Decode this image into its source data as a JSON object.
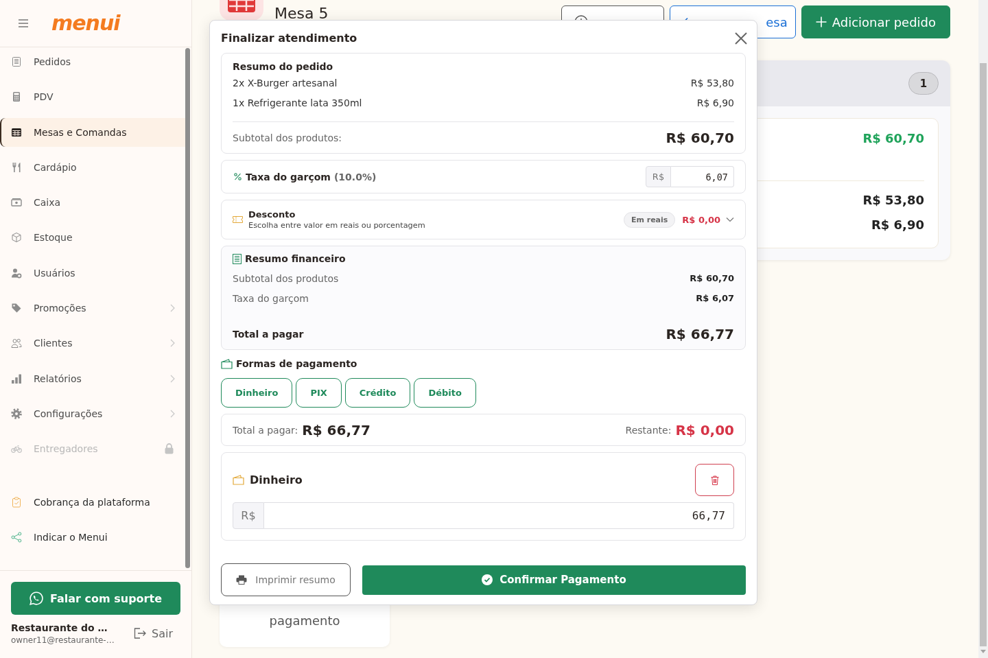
{
  "sidebar": {
    "logo": "menui",
    "items": [
      {
        "label": "Pedidos",
        "kind": "link",
        "selected": false,
        "disabled": false
      },
      {
        "label": "PDV",
        "kind": "link",
        "selected": false,
        "disabled": false
      },
      {
        "label": "Mesas e Comandas",
        "kind": "link",
        "selected": true,
        "disabled": false
      },
      {
        "label": "Cardápio",
        "kind": "link",
        "selected": false,
        "disabled": false
      },
      {
        "label": "Caixa",
        "kind": "link",
        "selected": false,
        "disabled": false
      },
      {
        "label": "Estoque",
        "kind": "link",
        "selected": false,
        "disabled": false
      },
      {
        "label": "Usuários",
        "kind": "link",
        "selected": false,
        "disabled": false
      },
      {
        "label": "Promoções",
        "kind": "group",
        "selected": false,
        "disabled": false
      },
      {
        "label": "Clientes",
        "kind": "group",
        "selected": false,
        "disabled": false
      },
      {
        "label": "Relatórios",
        "kind": "group",
        "selected": false,
        "disabled": false
      },
      {
        "label": "Configurações",
        "kind": "group",
        "selected": false,
        "disabled": false
      },
      {
        "label": "Entregadores",
        "kind": "link",
        "selected": false,
        "disabled": true
      }
    ],
    "extra_links": [
      {
        "label": "Cobrança da plataforma"
      },
      {
        "label": "Indicar o Menui"
      }
    ],
    "support_button": "Falar com suporte",
    "account": {
      "name": "Restaurante do …",
      "email": "owner11@restaurante-…",
      "logout": "Sair"
    }
  },
  "header": {
    "title": "Mesa 5",
    "buttons": [
      {
        "kind": "outline"
      },
      {
        "label": "esa",
        "kind": "secondary"
      },
      {
        "label": "Adicionar pedido",
        "kind": "primary"
      }
    ]
  },
  "hint_card": {
    "text": "pagamento"
  },
  "table_panel": {
    "count": "1",
    "total": "R$ 60,70",
    "prices": [
      "R$ 53,80",
      "R$ 6,90"
    ]
  },
  "modal": {
    "title": "Finalizar atendimento",
    "order_summary": {
      "title": "Resumo do pedido",
      "items": [
        {
          "name": "2x X-Burger artesanal",
          "price": "R$ 53,80"
        },
        {
          "name": "1x Refrigerante lata 350ml",
          "price": "R$ 6,90"
        }
      ],
      "subtotal_label": "Subtotal dos produtos:",
      "subtotal": "R$ 60,70"
    },
    "service_fee": {
      "label": "Taxa do garçom",
      "rate": "(10.0%)",
      "currency": "R$",
      "value": "6,07"
    },
    "discount": {
      "title": "Desconto",
      "subtitle": "Escolha entre valor em reais ou porcentagem",
      "mode": "Em reais",
      "value": "R$ 0,00"
    },
    "financial_summary": {
      "title": "Resumo financeiro",
      "rows": [
        {
          "label": "Subtotal dos produtos",
          "value": "R$ 60,70"
        },
        {
          "label": "Taxa do garçom",
          "value": "R$ 6,07"
        }
      ],
      "total_label": "Total a pagar",
      "total": "R$ 66,77"
    },
    "payment_methods": {
      "title": "Formas de pagamento",
      "options": [
        {
          "label": "Dinheiro",
          "selected": false
        },
        {
          "label": "PIX",
          "selected": false
        },
        {
          "label": "Crédito",
          "selected": false
        },
        {
          "label": "Débito",
          "selected": false
        }
      ]
    },
    "balance": {
      "total_label": "Total a pagar:",
      "total": "R$ 66,77",
      "remaining_label": "Restante:",
      "remaining": "R$ 0,00"
    },
    "payments": [
      {
        "method": "Dinheiro",
        "currency": "R$",
        "amount": "66,77"
      }
    ],
    "print_button": "Imprimir resumo",
    "confirm_button": "Confirmar Pagamento"
  }
}
